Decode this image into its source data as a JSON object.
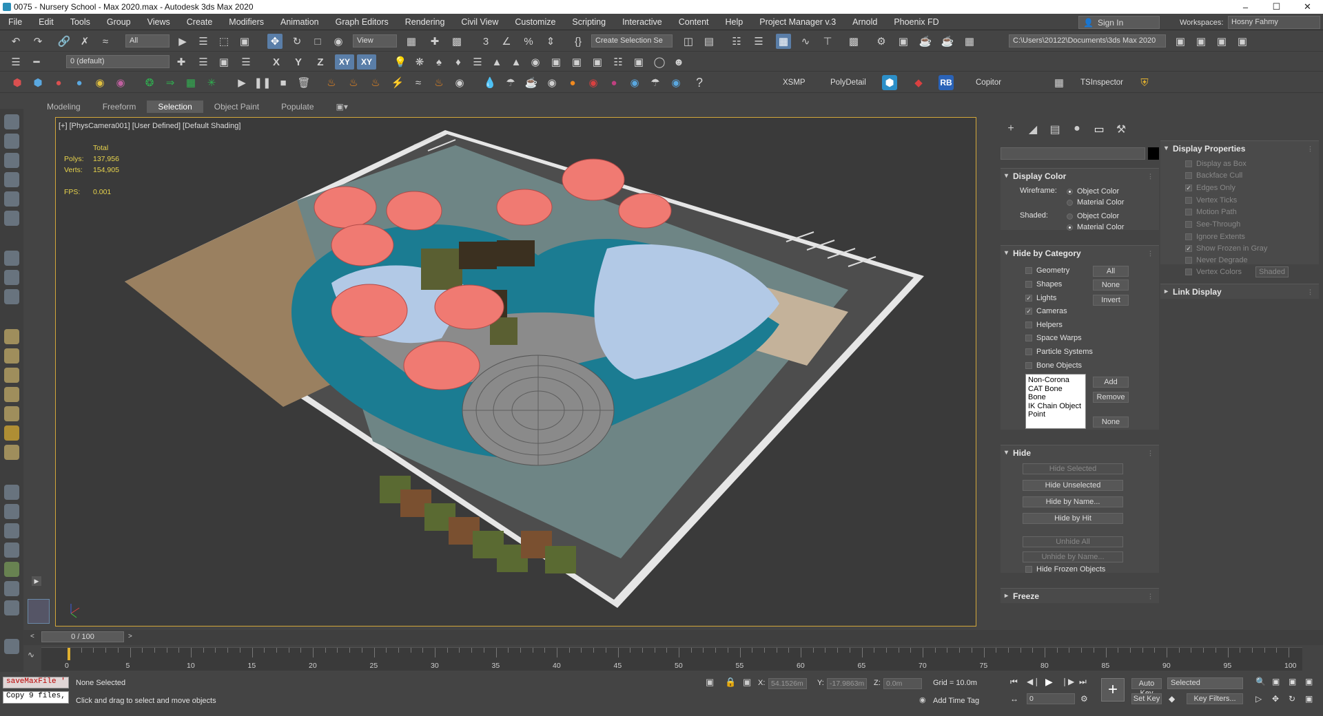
{
  "window": {
    "title": "0075 - Nursery School - Max 2020.max - Autodesk 3ds Max 2020",
    "min": "–",
    "max": "☐",
    "close": "✕"
  },
  "menu": [
    "File",
    "Edit",
    "Tools",
    "Group",
    "Views",
    "Create",
    "Modifiers",
    "Animation",
    "Graph Editors",
    "Rendering",
    "Civil View",
    "Customize",
    "Scripting",
    "Interactive",
    "Content",
    "Help",
    "Project Manager v.3",
    "Arnold",
    "Phoenix FD"
  ],
  "account": {
    "sign_in": "Sign In",
    "workspaces_label": "Workspaces:",
    "workspace": "Hosny Fahmy"
  },
  "toolbar": {
    "filter": "All",
    "view": "View",
    "selection_set": "Create Selection Se",
    "project_path": "C:\\Users\\20122\\Documents\\3ds Max 2020",
    "axis_x": "X",
    "axis_y": "Y",
    "axis_z": "Z",
    "axis_xy": "XY",
    "axis_xy2": "XY",
    "layer": "0 (default)",
    "xsmp": "XSMP",
    "polydetail": "PolyDetail",
    "rb": "RB",
    "copitor": "Copitor",
    "tsinspector": "TSInspector"
  },
  "ribbon": {
    "tabs": [
      "Modeling",
      "Freeform",
      "Selection",
      "Object Paint",
      "Populate"
    ],
    "selected": "Selection"
  },
  "viewport": {
    "label": "[+] [PhysCamera001] [User Defined] [Default Shading]",
    "stats_title": "Total",
    "polys_label": "Polys:",
    "polys": "137,956",
    "verts_label": "Verts:",
    "verts": "154,905",
    "fps_label": "FPS:",
    "fps": "0.001"
  },
  "command_panel": {
    "display_color": {
      "title": "Display Color",
      "wireframe_label": "Wireframe:",
      "shaded_label": "Shaded:",
      "object_color": "Object Color",
      "material_color": "Material Color"
    },
    "hide_by_category": {
      "title": "Hide by Category",
      "items": [
        "Geometry",
        "Shapes",
        "Lights",
        "Cameras",
        "Helpers",
        "Space Warps",
        "Particle Systems",
        "Bone Objects"
      ],
      "checked": [
        false,
        false,
        true,
        true,
        false,
        false,
        false,
        false
      ],
      "btn_all": "All",
      "btn_none": "None",
      "btn_invert": "Invert",
      "list": [
        "Non-Corona",
        "CAT Bone",
        "Bone",
        "IK Chain Object",
        "Point"
      ],
      "btn_add": "Add",
      "btn_remove": "Remove",
      "btn_none2": "None"
    },
    "hide": {
      "title": "Hide",
      "hide_selected": "Hide Selected",
      "hide_unselected": "Hide Unselected",
      "hide_by_name": "Hide by Name...",
      "hide_by_hit": "Hide by Hit",
      "unhide_all": "Unhide All",
      "unhide_by_name": "Unhide by Name...",
      "hide_frozen": "Hide Frozen Objects"
    },
    "freeze": {
      "title": "Freeze"
    },
    "display_properties": {
      "title": "Display Properties",
      "items": [
        "Display as Box",
        "Backface Cull",
        "Edges Only",
        "Vertex Ticks",
        "Motion Path",
        "See-Through",
        "Ignore Extents",
        "Show Frozen in Gray",
        "Never Degrade",
        "Vertex Colors"
      ],
      "checked": [
        false,
        false,
        true,
        false,
        false,
        false,
        false,
        true,
        false,
        false
      ],
      "shaded_btn": "Shaded"
    },
    "link_display": {
      "title": "Link Display"
    }
  },
  "timeline": {
    "slider": "0 / 100",
    "ticks": [
      0,
      5,
      10,
      15,
      20,
      25,
      30,
      35,
      40,
      45,
      50,
      55,
      60,
      65,
      70,
      75,
      80,
      85,
      90,
      95,
      100
    ]
  },
  "status": {
    "maxscript1": "saveMaxFile '",
    "maxscript2": "Copy 9 files,",
    "selection": "None Selected",
    "prompt": "Click and drag to select and move objects",
    "x_label": "X:",
    "x": "54.1526m",
    "y_label": "Y:",
    "y": "-17.9863m",
    "z_label": "Z:",
    "z": "0.0m",
    "grid": "Grid = 10.0m",
    "add_time_tag": "Add Time Tag",
    "auto_key": "Auto Key",
    "set_key": "Set Key",
    "key_mode": "Selected",
    "key_filters": "Key Filters...",
    "frame": "0"
  }
}
